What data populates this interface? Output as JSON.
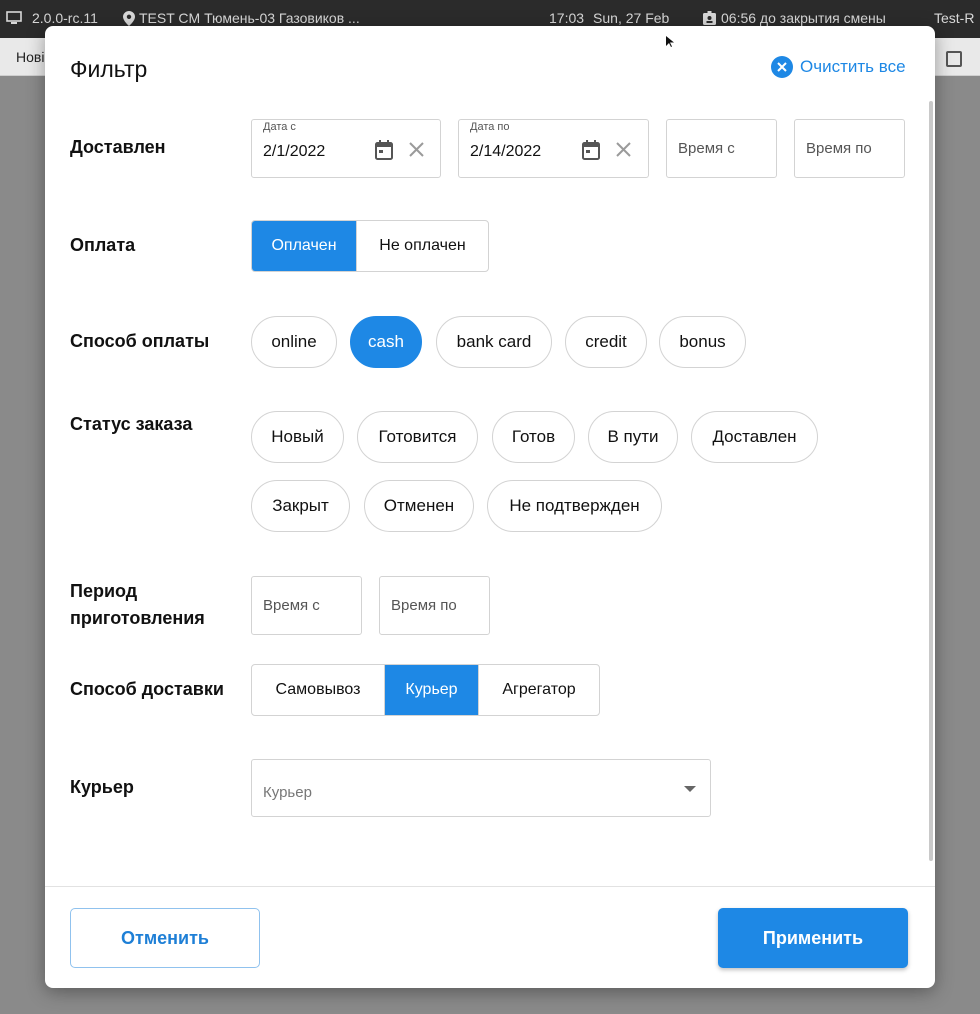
{
  "system_bar": {
    "version": "2.0.0-rc.11",
    "location": "TEST CM Тюмень-03 Газовиков ...",
    "time": "17:03",
    "date": "Sun, 27 Feb",
    "shift_close": "06:56 до закрытия смены",
    "user": "Test-R"
  },
  "app_bar": {
    "left_text": "Нові"
  },
  "filter": {
    "title": "Фильтр",
    "clear_all_label": "Очистить все",
    "delivered": {
      "label": "Доставлен",
      "date_from_label": "Дата с",
      "date_from_value": "2/1/2022",
      "date_to_label": "Дата по",
      "date_to_value": "2/14/2022",
      "time_from_placeholder": "Время с",
      "time_to_placeholder": "Время по"
    },
    "payment": {
      "label": "Оплата",
      "options": [
        "Оплачен",
        "Не оплачен"
      ],
      "selected": "Оплачен"
    },
    "payment_method": {
      "label": "Способ оплаты",
      "options": [
        "online",
        "cash",
        "bank card",
        "credit",
        "bonus"
      ],
      "selected": "cash"
    },
    "order_status": {
      "label": "Статус заказа",
      "options": [
        "Новый",
        "Готовится",
        "Готов",
        "В пути",
        "Доставлен",
        "Закрыт",
        "Отменен",
        "Не подтвержден"
      ]
    },
    "cooking_period": {
      "label_line1": "Период",
      "label_line2": "приготовления",
      "time_from_placeholder": "Время с",
      "time_to_placeholder": "Время по"
    },
    "delivery_method": {
      "label": "Способ доставки",
      "options": [
        "Самовывоз",
        "Курьер",
        "Агрегатор"
      ],
      "selected": "Курьер"
    },
    "courier": {
      "label": "Курьер",
      "placeholder": "Курьер"
    },
    "cancel_label": "Отменить",
    "apply_label": "Применить"
  },
  "colors": {
    "accent": "#1e88e5",
    "system_bar": "#2b2b2b"
  },
  "icons": [
    "monitor-icon",
    "location-pin-icon",
    "id-badge-icon",
    "close-circle-icon",
    "calendar-icon",
    "clear-icon",
    "dropdown-arrow-icon",
    "mouse-cursor-icon"
  ]
}
